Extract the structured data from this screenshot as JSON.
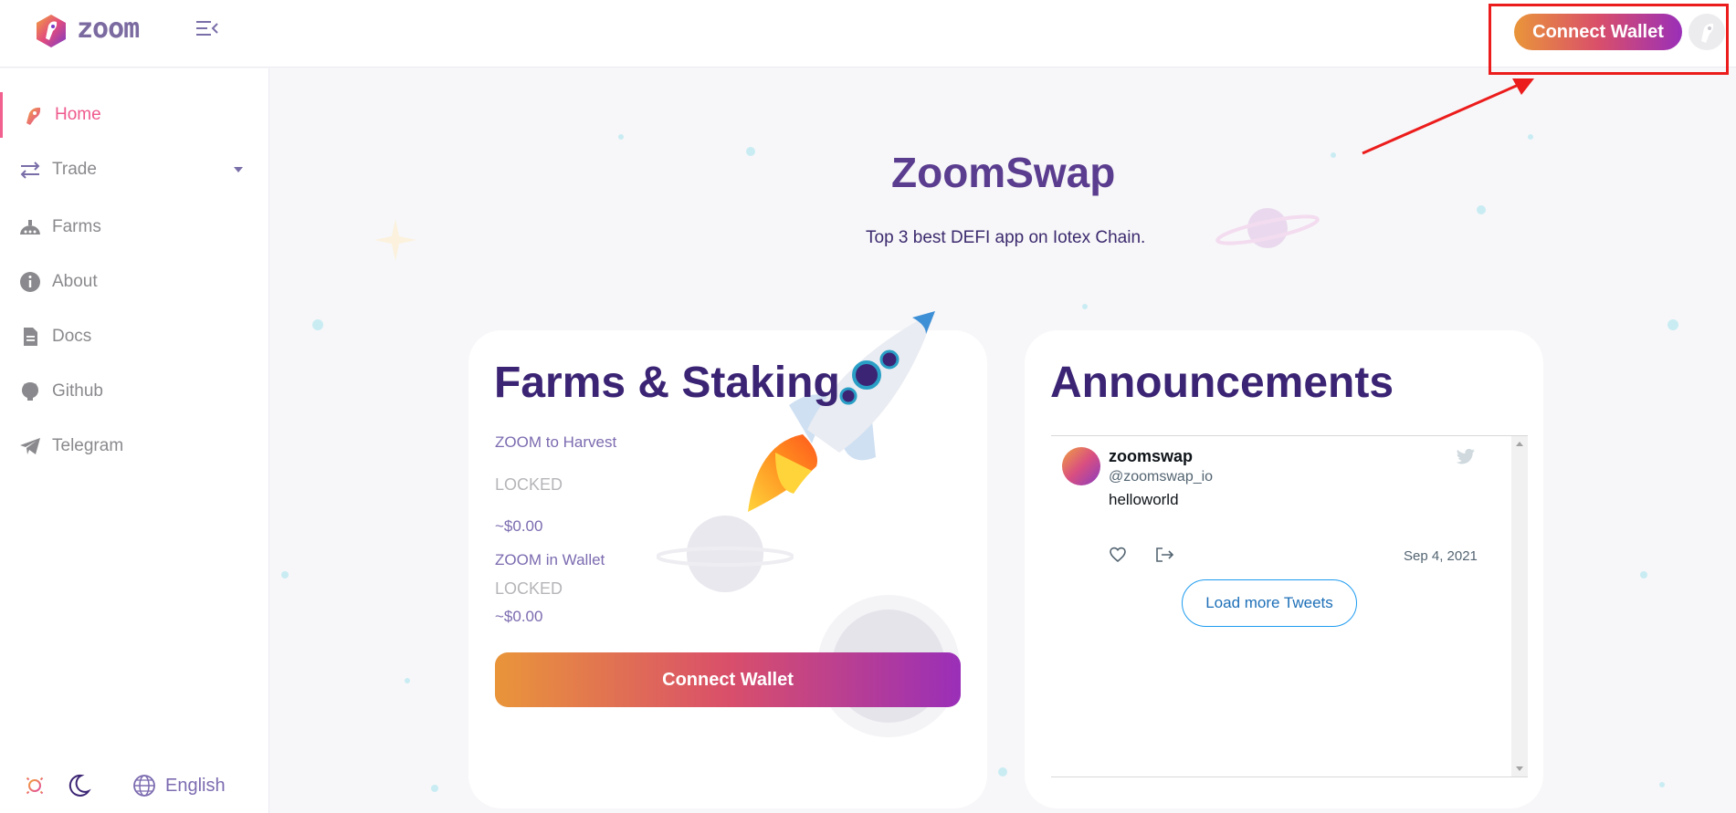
{
  "header": {
    "logo_text": "zoom",
    "connect_label": "Connect Wallet"
  },
  "sidebar": {
    "items": [
      {
        "label": "Home",
        "icon": "rocket-icon",
        "active": true
      },
      {
        "label": "Trade",
        "icon": "swap-arrows-icon",
        "has_dropdown": true
      },
      {
        "label": "Farms",
        "icon": "farm-icon"
      },
      {
        "label": "About",
        "icon": "info-icon"
      },
      {
        "label": "Docs",
        "icon": "document-icon"
      },
      {
        "label": "Github",
        "icon": "github-icon"
      },
      {
        "label": "Telegram",
        "icon": "telegram-icon"
      }
    ],
    "language": "English"
  },
  "main": {
    "title": "ZoomSwap",
    "subtitle": "Top 3 best DEFI app on Iotex Chain."
  },
  "farm_card": {
    "title": "Farms & Staking",
    "harvest_label": "ZOOM to Harvest",
    "harvest_status": "LOCKED",
    "harvest_value": "~$0.00",
    "wallet_label": "ZOOM in Wallet",
    "wallet_status": "LOCKED",
    "wallet_value": "~$0.00",
    "connect_label": "Connect Wallet"
  },
  "announcements": {
    "title": "Announcements",
    "tweet": {
      "name": "zoomswap",
      "handle": "@zoomswap_io",
      "text": "helloworld",
      "date": "Sep 4, 2021"
    },
    "load_more": "Load more Tweets"
  },
  "colors": {
    "accent_pink": "#ef5a8e",
    "brand_purple": "#3b2474",
    "gradient_start": "#e9953a",
    "gradient_end": "#9a2fb8",
    "annotation_red": "#ec1c1c"
  }
}
